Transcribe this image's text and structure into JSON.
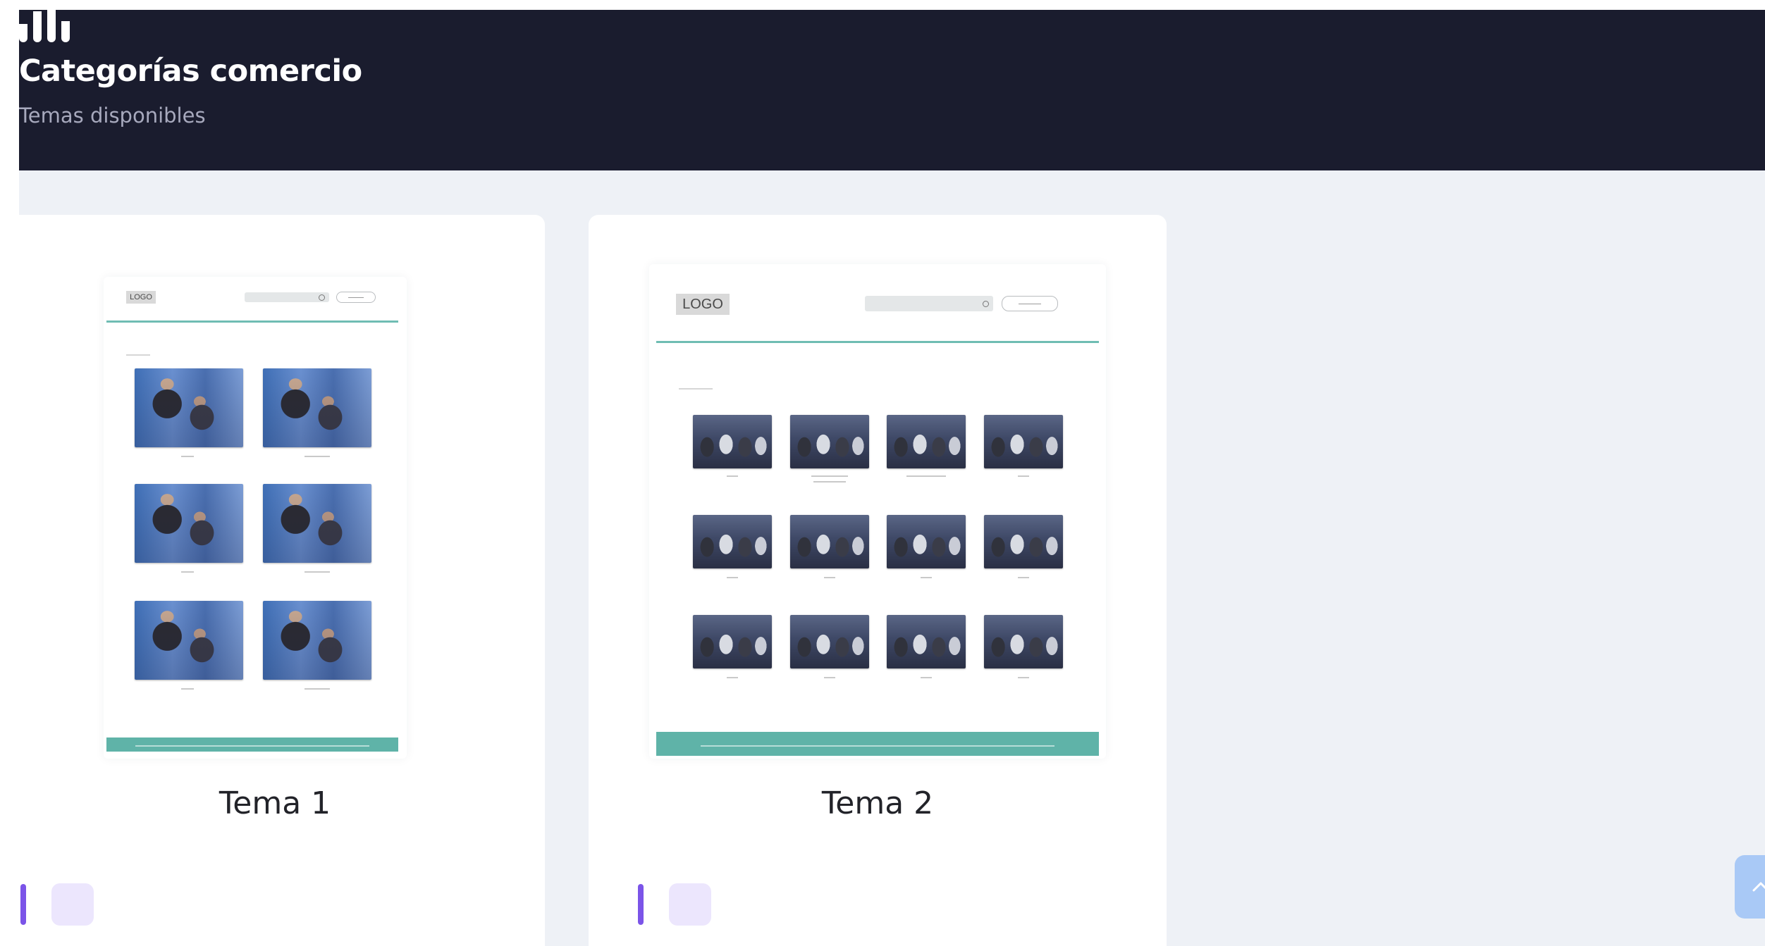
{
  "header": {
    "title": "Categorías comercio",
    "subtitle": "Temas disponibles",
    "brand_icon": "bar-chart-icon"
  },
  "themes": [
    {
      "name": "Tema 1",
      "preview": {
        "logo_text": "LOGO",
        "layout": "2-column product grid, 3 rows",
        "accent_color": "#6fbdb3"
      },
      "action_icon": "theme-action-icon"
    },
    {
      "name": "Tema 2",
      "preview": {
        "logo_text": "LOGO",
        "layout": "4-column product grid, 3 rows",
        "accent_color": "#5fb3a8"
      },
      "action_icon": "theme-action-icon"
    }
  ],
  "scroll_top": {
    "icon": "arrow-up-icon"
  },
  "colors": {
    "header_bg": "#1a1c2e",
    "page_bg": "#eef1f6",
    "accent_purple": "#7b54e8",
    "action_bg": "#ece6fd",
    "scroll_btn": "#a9c9f6"
  }
}
